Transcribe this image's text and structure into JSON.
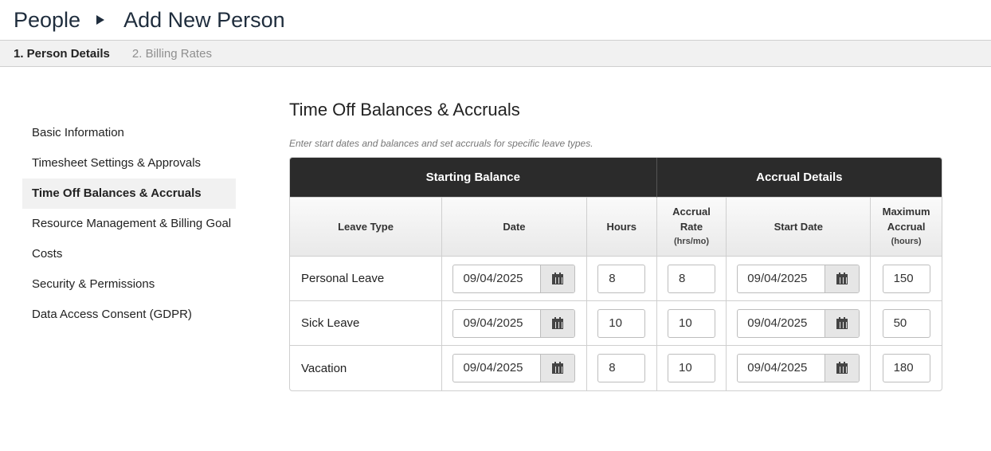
{
  "breadcrumb": {
    "root": "People",
    "current": "Add New Person"
  },
  "steps": [
    {
      "label": "1. Person Details"
    },
    {
      "label": "2. Billing Rates"
    }
  ],
  "sidebar": {
    "items": [
      {
        "label": "Basic Information"
      },
      {
        "label": "Timesheet Settings & Approvals"
      },
      {
        "label": "Time Off Balances & Accruals"
      },
      {
        "label": "Resource Management & Billing Goal"
      },
      {
        "label": "Costs"
      },
      {
        "label": "Security & Permissions"
      },
      {
        "label": "Data Access Consent (GDPR)"
      }
    ],
    "selected": "Time Off Balances & Accruals"
  },
  "section": {
    "title": "Time Off Balances & Accruals",
    "hint": "Enter start dates and balances and set accruals for specific leave types."
  },
  "table": {
    "groups": {
      "starting": "Starting Balance",
      "accrual": "Accrual Details"
    },
    "columns": {
      "leave_type": "Leave Type",
      "date": "Date",
      "hours": "Hours",
      "rate_line1": "Accrual",
      "rate_line2": "Rate",
      "rate_unit": "(hrs/mo)",
      "start_date": "Start Date",
      "max_line1": "Maximum",
      "max_line2": "Accrual",
      "max_unit": "(hours)"
    },
    "rows": [
      {
        "leave_type": "Personal Leave",
        "date": "09/04/2025",
        "hours": "8",
        "rate": "8",
        "start_date": "09/04/2025",
        "max": "150"
      },
      {
        "leave_type": "Sick Leave",
        "date": "09/04/2025",
        "hours": "10",
        "rate": "10",
        "start_date": "09/04/2025",
        "max": "50"
      },
      {
        "leave_type": "Vacation",
        "date": "09/04/2025",
        "hours": "8",
        "rate": "10",
        "start_date": "09/04/2025",
        "max": "180"
      }
    ]
  },
  "icons": {
    "calendar": "calendar-icon",
    "breadcrumb_separator": "caret-right-icon"
  },
  "colors": {
    "header_dark": "#2b2b2b",
    "selected_bg": "#f1f1f1",
    "title": "#1f2d3d"
  }
}
